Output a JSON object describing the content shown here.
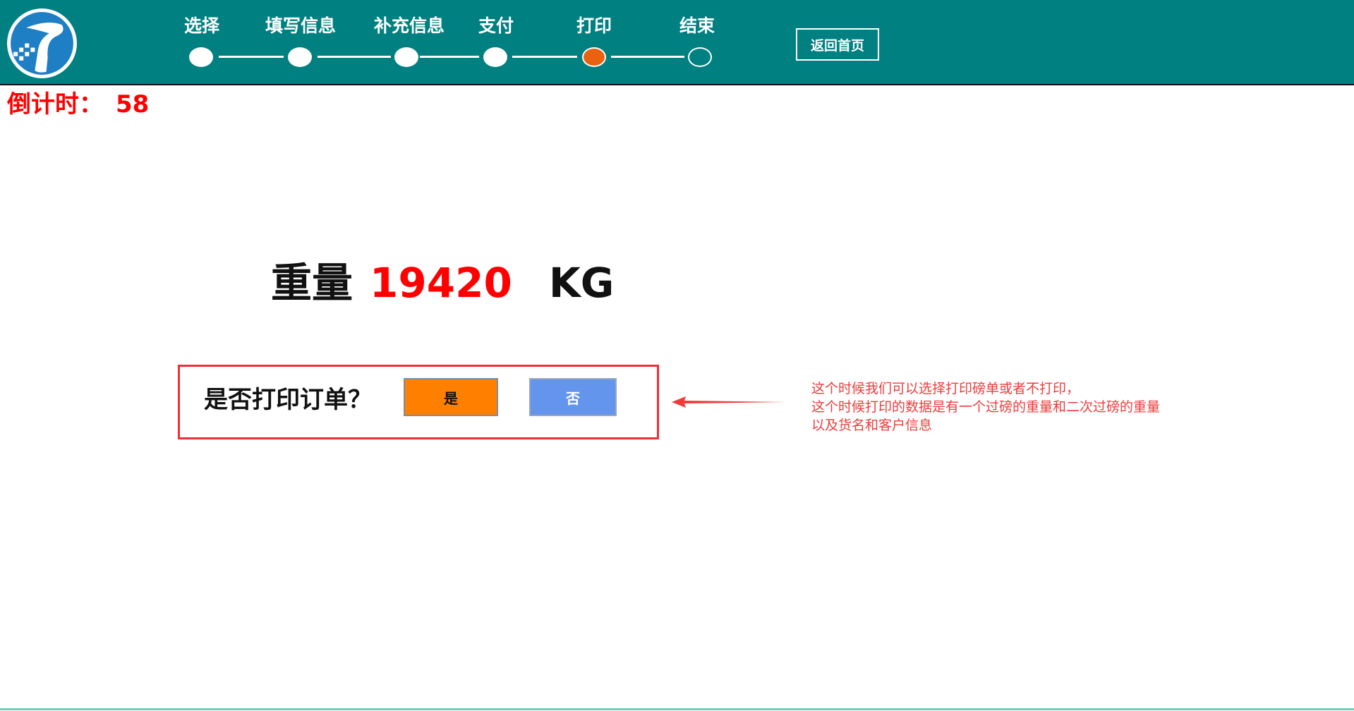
{
  "header": {
    "background_color": "#008080",
    "steps": [
      {
        "label": "选择",
        "state": "done"
      },
      {
        "label": "填写信息",
        "state": "done"
      },
      {
        "label": "补充信息",
        "state": "done"
      },
      {
        "label": "支付",
        "state": "done"
      },
      {
        "label": "打印",
        "state": "current"
      },
      {
        "label": "结束",
        "state": "pending"
      }
    ],
    "current_step_color": "#e8620f",
    "home_button_label": "返回首页"
  },
  "countdown": {
    "label": "倒计时：",
    "value": "58"
  },
  "weight": {
    "label": "重量",
    "value": "19420",
    "unit": "KG"
  },
  "print_dialog": {
    "question": "是否打印订单？",
    "yes_label": "是",
    "no_label": "否",
    "yes_color": "#ff8000",
    "no_color": "#6495ed"
  },
  "annotation": {
    "lines": [
      "这个时候我们可以选择打印磅单或者不打印，",
      "这个时候打印的数据是有一个过磅的重量和二次过磅的重量",
      "以及货名和客户信息"
    ],
    "color": "#ef3b3b"
  }
}
